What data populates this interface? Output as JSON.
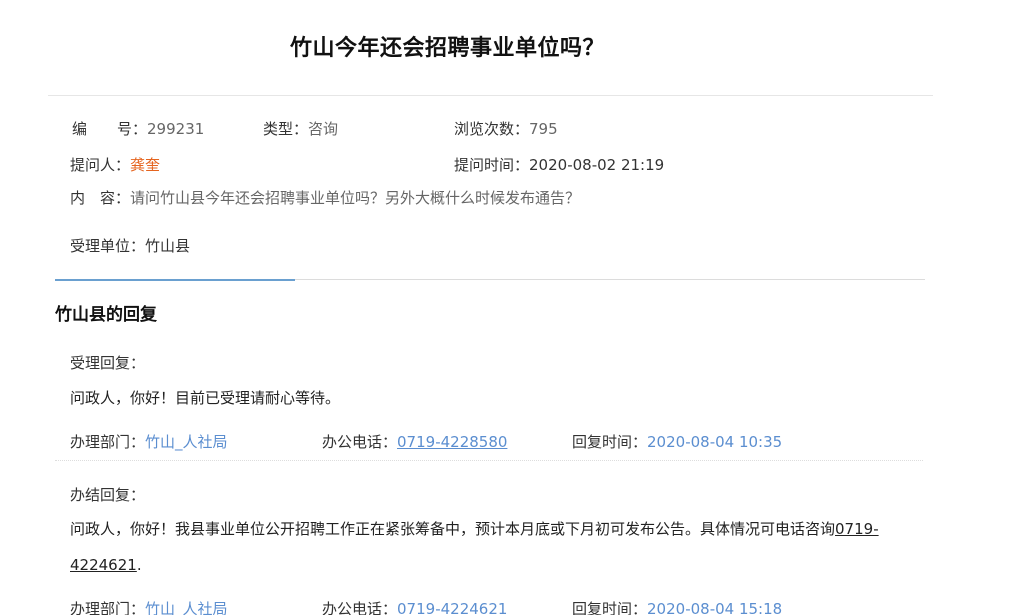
{
  "question": {
    "title": "竹山今年还会招聘事业单位吗？",
    "number_label": "编　　号：",
    "number_value": "299231",
    "type_label": "类型：",
    "type_value": "咨询",
    "views_label": "浏览次数：",
    "views_value": "795",
    "asker_label": "提问人：",
    "asker_value": "龚奎",
    "ask_time_label": "提问时间：",
    "ask_time_value": "2020-08-02 21:19",
    "content_label": "内　容：",
    "content_value": "请问竹山县今年还会招聘事业单位吗？另外大概什么时候发布通告？",
    "unit_label": "受理单位：",
    "unit_value": "竹山县"
  },
  "reply": {
    "section_title": "竹山县的回复",
    "accept": {
      "label": "受理回复：",
      "text": "问政人，你好！目前已受理请耐心等待。",
      "dept_label": "办理部门：",
      "dept_value": "竹山_人社局",
      "phone_label": "办公电话：",
      "phone_value": "0719-4228580",
      "time_label": "回复时间：",
      "time_value": "2020-08-04 10:35"
    },
    "final": {
      "label": "办结回复：",
      "text_before": "问政人，你好！我县事业单位公开招聘工作正在紧张筹备中，预计本月底或下月初可发布公告。具体情况可电话咨询",
      "text_phone_a": "0719-",
      "text_phone_b": "4224621",
      "text_after": ".",
      "dept_label": "办理部门：",
      "dept_value": "竹山_人社局",
      "phone_label": "办公电话：",
      "phone_value": "0719-4224621",
      "time_label": "回复时间：",
      "time_value": "2020-08-04 15:18"
    }
  }
}
